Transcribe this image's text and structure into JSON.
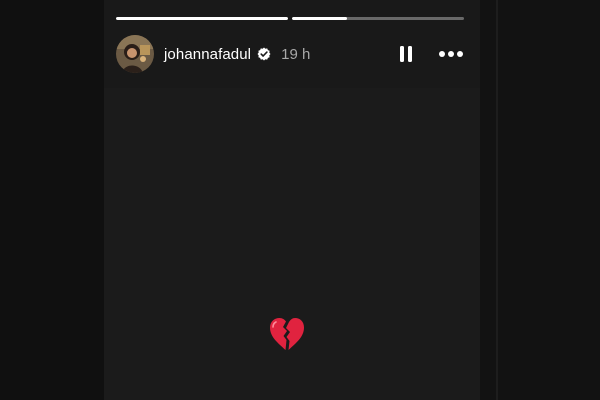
{
  "story": {
    "progress": [
      1.0,
      0.32
    ],
    "username": "johannafadul",
    "verified": true,
    "time": "19 h",
    "content_emoji": "broken-heart"
  },
  "icons": {
    "verified": "verified-badge-icon",
    "pause": "pause-icon",
    "more": "more-options-icon",
    "emoji": "broken-heart-icon"
  },
  "colors": {
    "background": "#0f0f0f",
    "story_background": "#1b1b1b",
    "text": "#ffffff",
    "muted_text": "#a8a8a8",
    "heart": "#e0233f"
  }
}
